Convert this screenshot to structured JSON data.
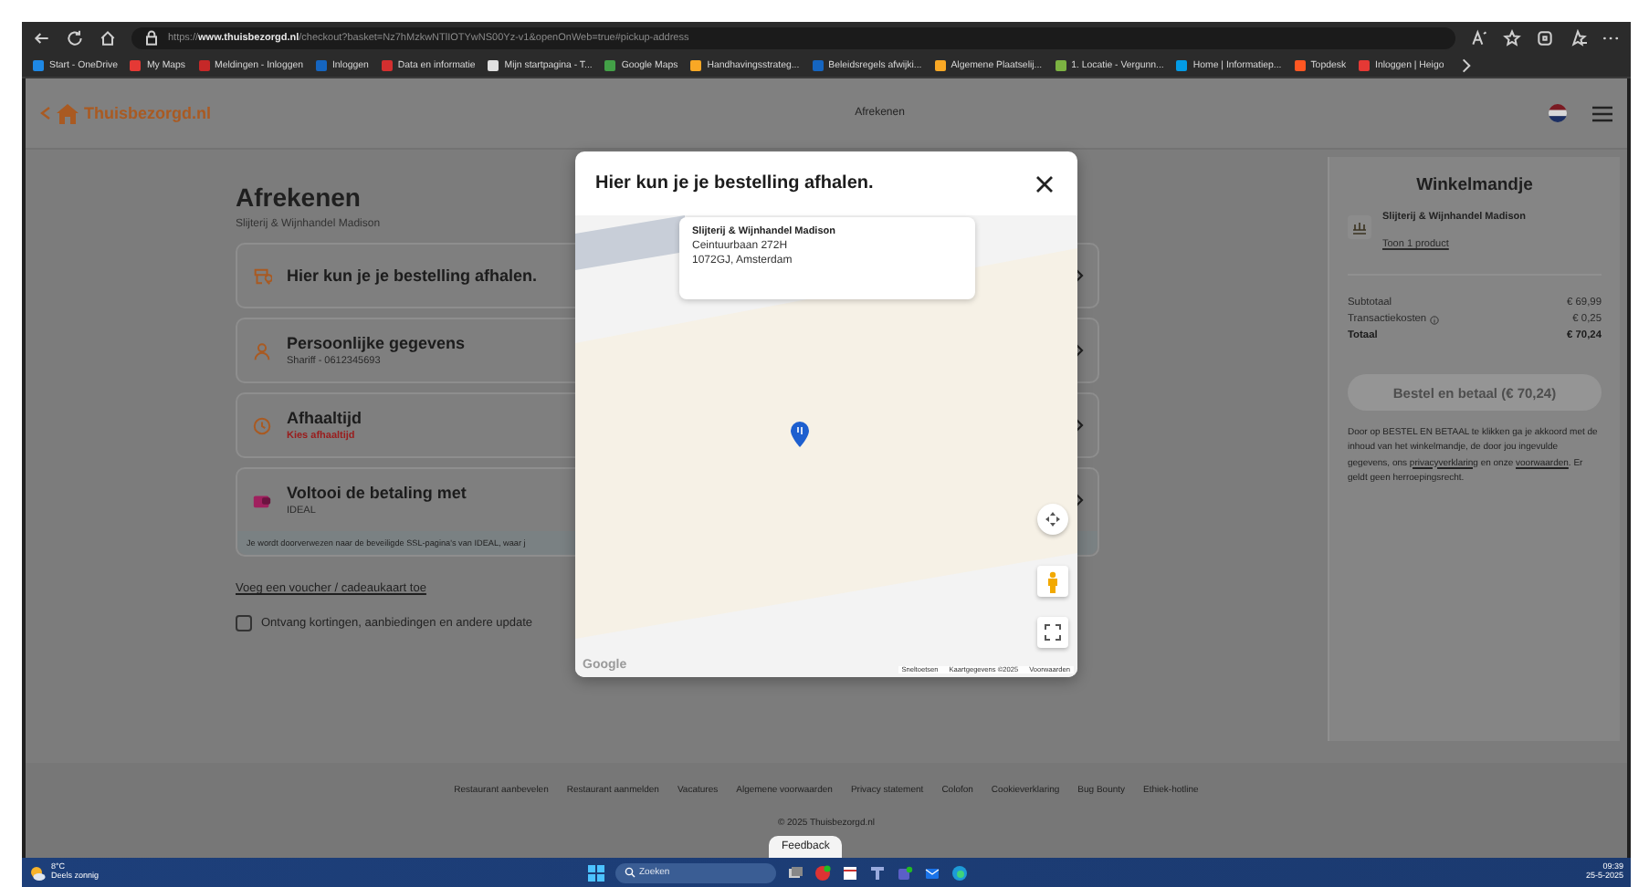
{
  "browser": {
    "url": "https://**www.thuisbezorgd.nl**/checkout?basket=Nz7hMzkwNTlIOTYwNS00Yz-v1&openOnWeb=true#pickup-address",
    "bookmarks": [
      {
        "label": "Start - OneDrive",
        "color": "#1e88e5"
      },
      {
        "label": "My Maps",
        "color": "#e53935"
      },
      {
        "label": "Meldingen - Inloggen",
        "color": "#c62828"
      },
      {
        "label": "Inloggen",
        "color": "#1565c0"
      },
      {
        "label": "Data en informatie",
        "color": "#d32f2f"
      },
      {
        "label": "Mijn startpagina - T...",
        "color": "#e0e0e0"
      },
      {
        "label": "Google Maps",
        "color": "#43a047"
      },
      {
        "label": "Handhavingsstrateg...",
        "color": "#f9a825"
      },
      {
        "label": "Beleidsregels afwijki...",
        "color": "#1565c0"
      },
      {
        "label": "Algemene Plaatselij...",
        "color": "#f9a825"
      },
      {
        "label": "1. Locatie - Vergunn...",
        "color": "#7cb342"
      },
      {
        "label": "Home | Informatiep...",
        "color": "#039be5"
      },
      {
        "label": "Topdesk",
        "color": "#ff5722"
      },
      {
        "label": "Inloggen | Heigo",
        "color": "#e53935"
      }
    ]
  },
  "header": {
    "logo": "Thuisbezorgd.nl",
    "title": "Afrekenen"
  },
  "checkout": {
    "title": "Afrekenen",
    "subtitle": "Slijterij & Wijnhandel Madison",
    "sections": [
      {
        "kind": "pickup",
        "title": "Hier kun je je bestelling afhalen."
      },
      {
        "kind": "personal",
        "title": "Persoonlijke gegevens",
        "subtitle": "Shariff - 0612345693",
        "alert": false
      },
      {
        "kind": "time",
        "title": "Afhaaltijd",
        "subtitle": "Kies afhaaltijd",
        "alert": true
      },
      {
        "kind": "payment",
        "title": "Voltooi de betaling met",
        "subtitle": "IDEAL",
        "alert": false
      }
    ],
    "payment_note": "Je wordt doorverwezen naar de beveiligde SSL-pagina's van IDEAL, waar j",
    "voucher_link": "Voeg een voucher / cadeaukaart toe",
    "newsletter": {
      "label": "Ontvang kortingen, aanbiedingen en andere update",
      "checked": false
    }
  },
  "cart": {
    "title": "Winkelmandje",
    "restaurant": "Slijterij & Wijnhandel Madison",
    "product_link": "Toon 1 product",
    "rows": [
      {
        "kind": "plain",
        "label": "Subtotaal",
        "value": "€ 69,99"
      },
      {
        "kind": "info",
        "label": "Transactiekosten",
        "value": "€ 0,25"
      },
      {
        "kind": "total",
        "label": "Totaal",
        "value": "€ 70,24"
      }
    ],
    "button": {
      "label": "Bestel en betaal (€ 70,24)",
      "disabled": true
    },
    "legal": {
      "before": "Door op BESTEL EN BETAAL te klikken ga je akkoord met de inhoud van het winkelmandje, de door jou ingevulde gegevens, ons",
      "privacy_link": "privacyverklaring",
      "middle": "en onze",
      "terms_link": "voorwaarden",
      "after": ". Er geldt geen herroepingsrecht."
    }
  },
  "modal": {
    "title": "Hier kun je je bestelling afhalen.",
    "place": {
      "name": "Slijterij & Wijnhandel Madison",
      "street": "Ceintuurbaan 272H",
      "city": "1072GJ, Amsterdam"
    },
    "map_logo": "Google",
    "attribution": [
      "Sneltoetsen",
      "Kaartgegevens ©2025",
      "Voorwaarden"
    ]
  },
  "footer": {
    "links": [
      "Restaurant aanbevelen",
      "Restaurant aanmelden",
      "Vacatures",
      "Algemene voorwaarden",
      "Privacy statement",
      "Colofon",
      "Cookieverklaring",
      "Bug Bounty",
      "Ethiek-hotline"
    ],
    "copyright": "© 2025 Thuisbezorgd.nl",
    "feedback": "Feedback"
  },
  "taskbar": {
    "temperature": "8°C",
    "condition": "Deels zonnig",
    "search_placeholder": "Zoeken",
    "time": "09:39",
    "date": "25-5-2025"
  }
}
